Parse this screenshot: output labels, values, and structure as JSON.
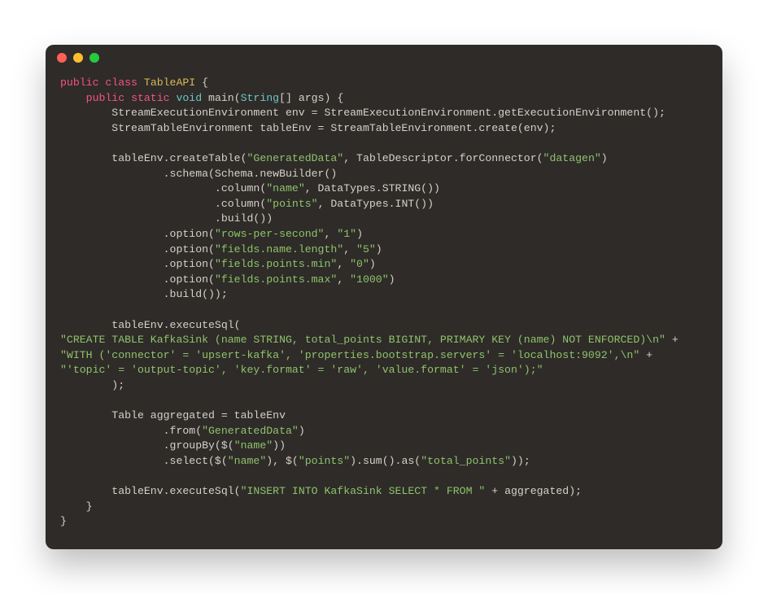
{
  "tokens": {
    "kw_public": "public",
    "kw_class": "class",
    "cls_name": "TableAPI",
    "kw_static": "static",
    "kw_void": "void",
    "main_sig1": " main(",
    "t_string": "String",
    "main_sig2": "[] args) {",
    "l3": "        StreamExecutionEnvironment env = StreamExecutionEnvironment.getExecutionEnvironment();",
    "l4": "        StreamTableEnvironment tableEnv = StreamTableEnvironment.create(env);",
    "l6a": "        tableEnv.createTable(",
    "s_gen": "\"GeneratedData\"",
    "l6b": ", TableDescriptor.forConnector(",
    "s_datagen": "\"datagen\"",
    "l6c": ")",
    "l7": "                .schema(Schema.newBuilder()",
    "l8a": "                        .column(",
    "s_name": "\"name\"",
    "l8b": ", DataTypes.STRING())",
    "s_points": "\"points\"",
    "l9b": ", DataTypes.INT())",
    "l10": "                        .build())",
    "l11a": "                .option(",
    "s_rps": "\"rows-per-second\"",
    "comma": ", ",
    "s_1": "\"1\"",
    "paren": ")",
    "s_fnl": "\"fields.name.length\"",
    "s_5": "\"5\"",
    "s_fpmin": "\"fields.points.min\"",
    "s_0": "\"0\"",
    "s_fpmax": "\"fields.points.max\"",
    "s_1000": "\"1000\"",
    "l16": "                .build());",
    "l18": "        tableEnv.executeSql(",
    "s_sql1": "\"CREATE TABLE KafkaSink (name STRING, total_points BIGINT, PRIMARY KEY (name) NOT ENFORCED)\\n\"",
    "plus": " +",
    "s_sql2": "\"WITH ('connector' = 'upsert-kafka', 'properties.bootstrap.servers' = 'localhost:9092',\\n\"",
    "s_sql3": "\"'topic' = 'output-topic', 'key.format' = 'raw', 'value.format' = 'json');\"",
    "l22": "        );",
    "l24": "        Table aggregated = tableEnv",
    "l25a": "                .from(",
    "l26a": "                .groupBy($(",
    "l26b": "))",
    "l27a": "                .select($(",
    "l27b": "), $(",
    "l27c": ").sum().as(",
    "s_total": "\"total_points\"",
    "l27d": "));",
    "l29a": "        tableEnv.executeSql(",
    "s_insert": "\"INSERT INTO KafkaSink SELECT * FROM \"",
    "l29b": " + aggregated);",
    "l30": "    }",
    "l31": "}"
  }
}
